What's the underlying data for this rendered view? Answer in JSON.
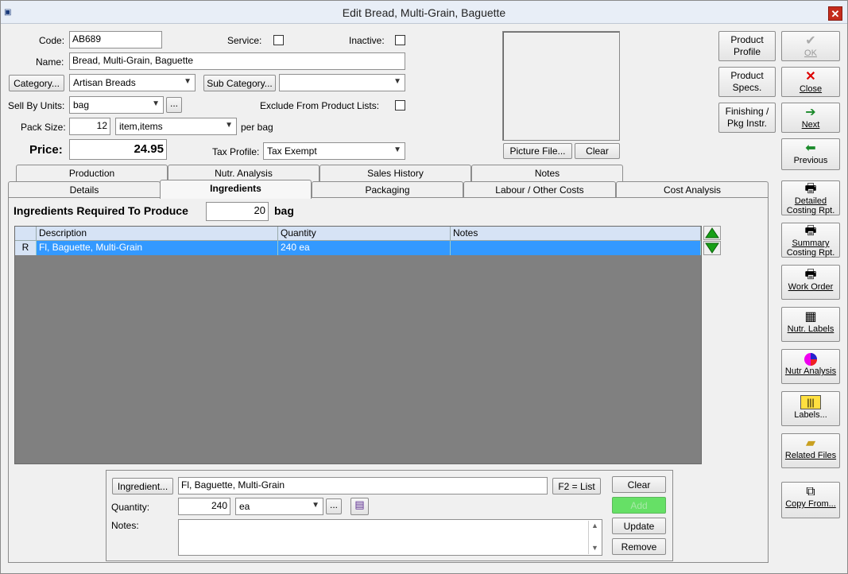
{
  "window": {
    "title": "Edit Bread, Multi-Grain, Baguette",
    "close_label": "✕"
  },
  "form": {
    "code_label": "Code:",
    "code_value": "AB689",
    "service_label": "Service:",
    "inactive_label": "Inactive:",
    "name_label": "Name:",
    "name_value": "Bread, Multi-Grain, Baguette",
    "category_button": "Category...",
    "category_value": "Artisan Breads",
    "subcategory_button": "Sub Category...",
    "subcategory_value": "",
    "sell_by_label": "Sell By Units:",
    "sell_by_value": "bag",
    "ellipsis": "...",
    "exclude_label": "Exclude From Product Lists:",
    "pack_size_label": "Pack Size:",
    "pack_size_value": "12",
    "pack_unit_value": "item,items",
    "per_bag_label": "per bag",
    "price_label": "Price:",
    "price_value": "24.95",
    "tax_label": "Tax Profile:",
    "tax_value": "Tax Exempt",
    "picture_file_button": "Picture File...",
    "picture_clear_button": "Clear"
  },
  "top_buttons": {
    "product_profile": [
      "Product",
      "Profile"
    ],
    "product_specs": [
      "Product",
      "Specs."
    ],
    "finishing": [
      "Finishing /",
      "Pkg Instr."
    ]
  },
  "nav_buttons": {
    "ok": "OK",
    "close": "Close",
    "next": "Next",
    "previous": "Previous"
  },
  "tabs_row1": [
    "Production",
    "Nutr. Analysis",
    "Sales History",
    "Notes"
  ],
  "tabs_row2": [
    "Details",
    "Ingredients",
    "Packaging",
    "Labour / Other Costs",
    "Cost Analysis"
  ],
  "ingredients": {
    "produce_label": "Ingredients Required To Produce",
    "produce_qty": "20",
    "produce_unit": "bag",
    "columns": [
      "Description",
      "Quantity",
      "Notes"
    ],
    "rows": [
      {
        "marker": "R",
        "description": "Fl, Baguette, Multi-Grain",
        "quantity": "240 ea",
        "notes": ""
      }
    ]
  },
  "editor": {
    "ingredient_button": "Ingredient...",
    "ingredient_value": "Fl, Baguette, Multi-Grain",
    "f2_button": "F2 = List",
    "quantity_label": "Quantity:",
    "quantity_value": "240",
    "unit_value": "ea",
    "ellipsis": "...",
    "notes_label": "Notes:",
    "clear_button": "Clear",
    "add_button": "Add",
    "update_button": "Update",
    "remove_button": "Remove"
  },
  "side_buttons": {
    "detailed": [
      "Detailed",
      "Costing Rpt."
    ],
    "summary": [
      "Summary",
      "Costing Rpt."
    ],
    "work_order": "Work Order",
    "nutr_labels": "Nutr. Labels",
    "nutr_analysis": "Nutr Analysis",
    "labels": "Labels...",
    "related_files": "Related Files",
    "copy_from": "Copy From..."
  },
  "colors": {
    "selection": "#3399ff",
    "grid_bg": "#808080",
    "add_button": "#66e066",
    "close_red": "#c42b1c"
  }
}
